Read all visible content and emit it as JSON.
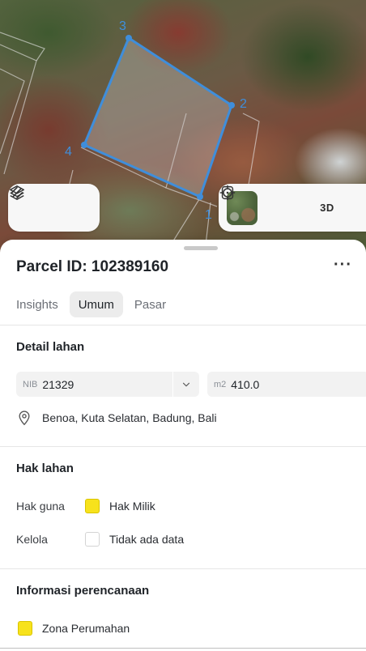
{
  "map": {
    "vertex_labels": [
      "1",
      "2",
      "3",
      "4"
    ],
    "toolbar": {
      "layers_icon": "layers-icon",
      "draw_icon": "draw-line-icon",
      "basemap_thumbnail": "satellite-basemap-thumbnail",
      "locate_icon": "crosshair-icon",
      "view_3d_label": "3D"
    },
    "accent_color": "#3b8fe0"
  },
  "parcel": {
    "title": "Parcel ID: 102389160",
    "more_label": "···"
  },
  "tabs": [
    {
      "label": "Insights",
      "active": false
    },
    {
      "label": "Umum",
      "active": true
    },
    {
      "label": "Pasar",
      "active": false
    }
  ],
  "detail_lahan": {
    "title": "Detail lahan",
    "nib_prefix": "NIB",
    "nib_value": "21329",
    "area_prefix": "m2",
    "area_value": "410.0",
    "location": "Benoa, Kuta Selatan, Badung, Bali"
  },
  "hak_lahan": {
    "title": "Hak lahan",
    "rows": [
      {
        "label": "Hak guna",
        "value": "Hak Milik",
        "swatch_color": "#f7e21c"
      },
      {
        "label": "Kelola",
        "value": "Tidak ada data",
        "swatch_color": "#ffffff"
      }
    ]
  },
  "perencanaan": {
    "title": "Informasi perencanaan",
    "zone_label": "Zona Perumahan",
    "zone_color": "#f7e21c"
  }
}
